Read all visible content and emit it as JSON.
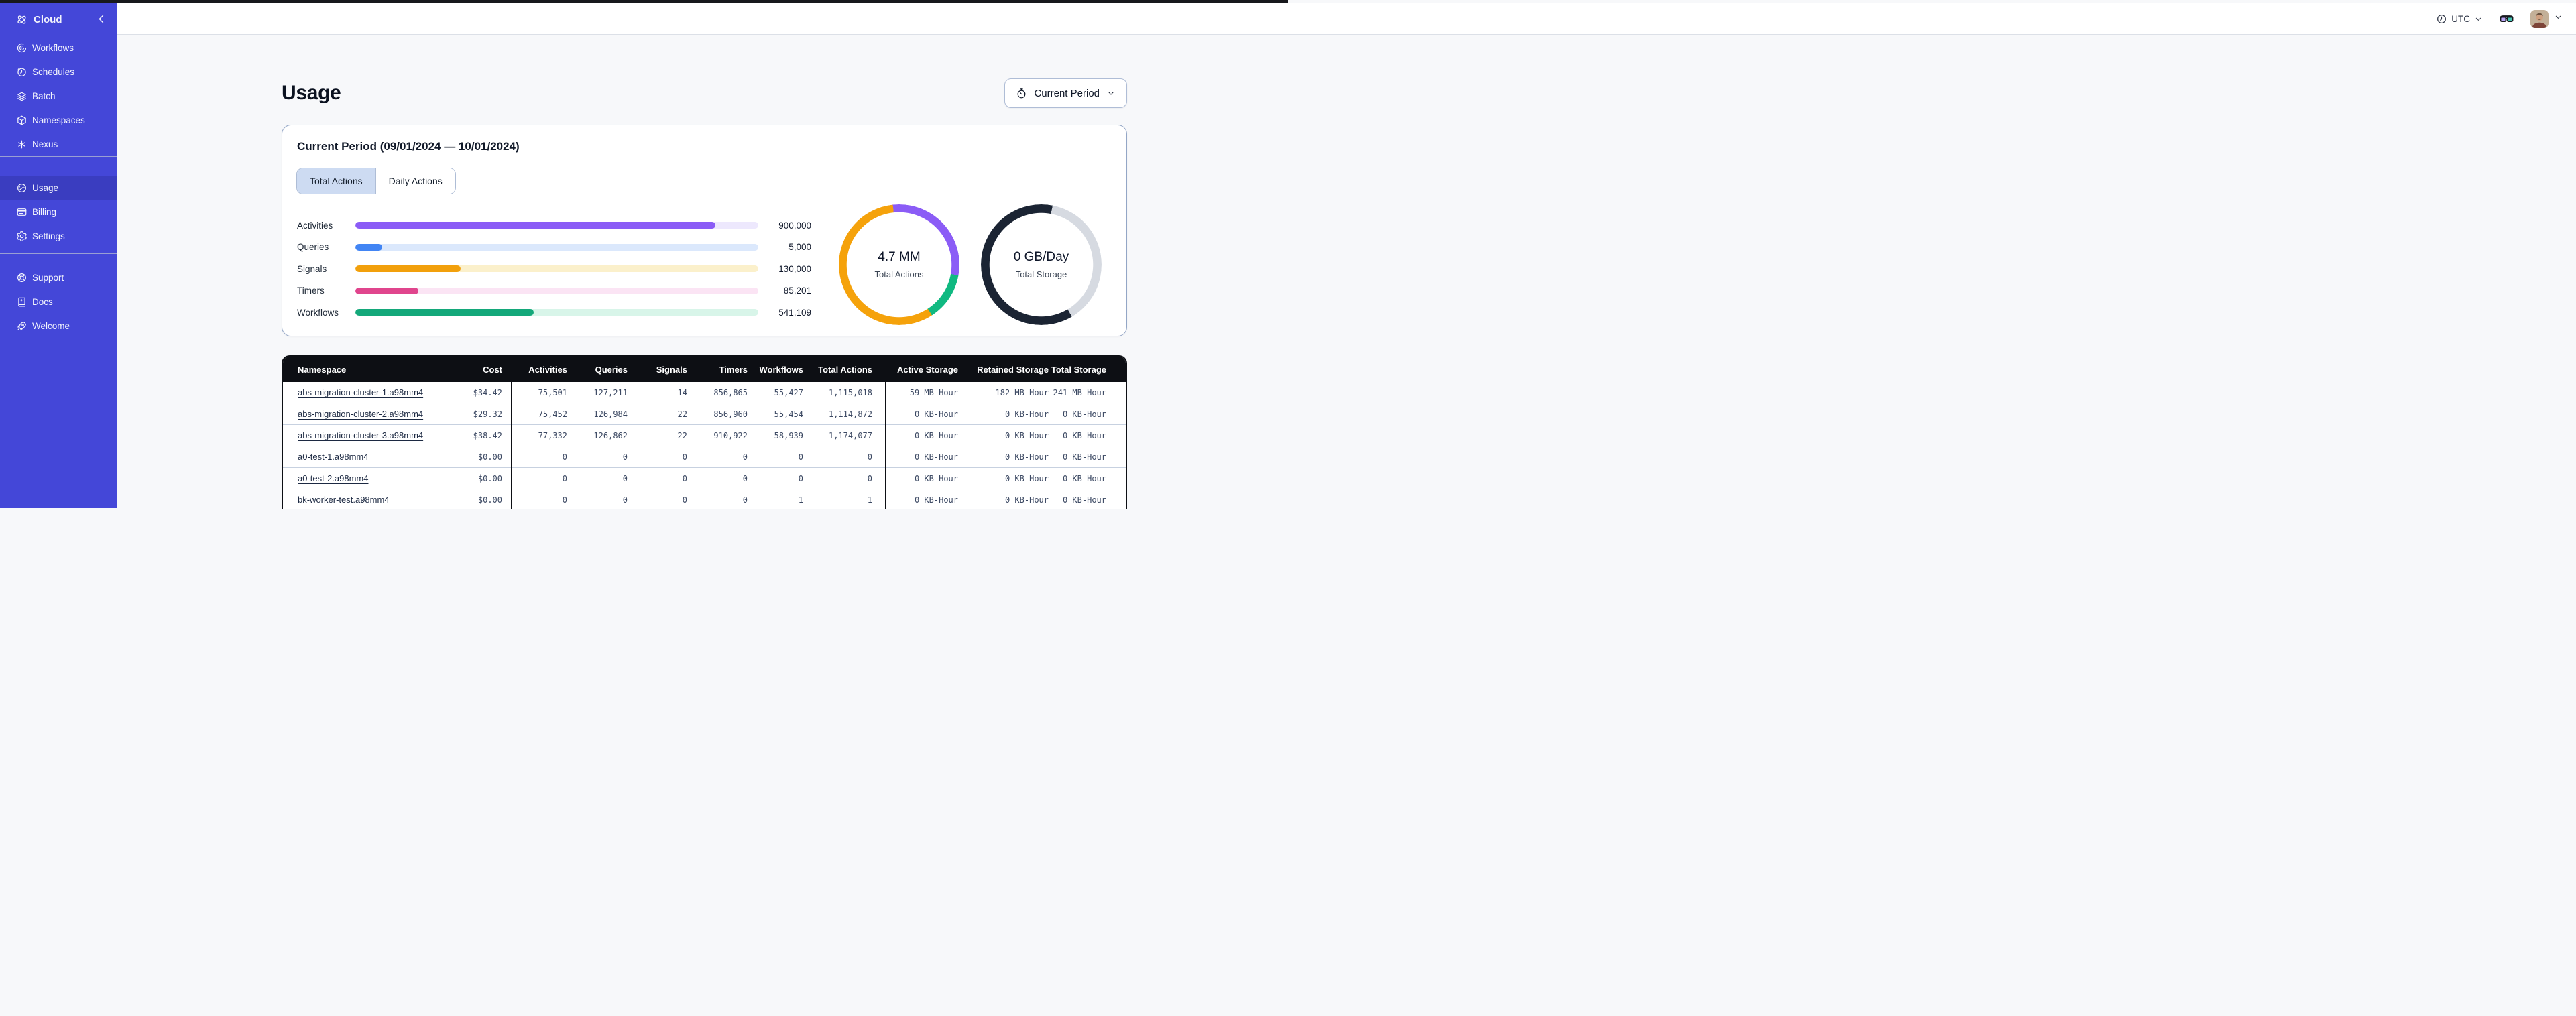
{
  "topbar": {
    "timezone": "UTC"
  },
  "sidebar": {
    "brand": {
      "label": "Cloud",
      "icon": "temporal-logo-icon"
    },
    "groups": [
      {
        "items": [
          {
            "label": "Workflows",
            "icon": "workflows-icon"
          },
          {
            "label": "Schedules",
            "icon": "schedules-icon"
          },
          {
            "label": "Batch",
            "icon": "batch-icon"
          },
          {
            "label": "Namespaces",
            "icon": "namespaces-icon"
          },
          {
            "label": "Nexus",
            "icon": "nexus-icon"
          }
        ]
      },
      {
        "items": [
          {
            "label": "Usage",
            "icon": "usage-icon",
            "active": true
          },
          {
            "label": "Billing",
            "icon": "billing-icon"
          },
          {
            "label": "Settings",
            "icon": "settings-icon"
          }
        ]
      },
      {
        "items": [
          {
            "label": "Support",
            "icon": "support-icon"
          },
          {
            "label": "Docs",
            "icon": "docs-icon"
          },
          {
            "label": "Welcome",
            "icon": "welcome-icon"
          }
        ]
      }
    ]
  },
  "page": {
    "title": "Usage",
    "period_button": "Current Period"
  },
  "usage_card": {
    "heading": "Current Period (09/01/2024 — 10/01/2024)",
    "tabs": [
      {
        "label": "Total Actions",
        "selected": true
      },
      {
        "label": "Daily Actions",
        "selected": false
      }
    ]
  },
  "chart_data": [
    {
      "type": "bar",
      "title": "Total Actions by type",
      "orientation": "horizontal",
      "categories": [
        "Activities",
        "Queries",
        "Signals",
        "Timers",
        "Workflows"
      ],
      "values": [
        900000,
        5000,
        130000,
        85201,
        541109
      ],
      "value_labels": [
        "900,000",
        "5,000",
        "130,000",
        "85,201",
        "541,109"
      ],
      "fill_percents": [
        89.4,
        6.7,
        26.2,
        15.6,
        44.2
      ],
      "bar_colors": [
        "#8B5CF6",
        "#4285F4",
        "#F2A00C",
        "#E0458D",
        "#14A87A"
      ],
      "track_colors": [
        "#EDE8FD",
        "#DBE8FC",
        "#FBF0CB",
        "#FBE4F4",
        "#D8F5E9"
      ]
    },
    {
      "type": "donut",
      "center_value": "4.7 MM",
      "center_label": "Total Actions",
      "start_deg": -6,
      "thickness_px": 12,
      "segments": [
        {
          "color": "#8B5CF6",
          "from_pct": 0,
          "to_pct": 29.5
        },
        {
          "color": "#10B981",
          "from_pct": 29.5,
          "to_pct": 42.5
        },
        {
          "color": "#F5A20B",
          "from_pct": 42.5,
          "to_pct": 100
        }
      ]
    },
    {
      "type": "donut",
      "center_value": "0 GB/Day",
      "center_label": "Total Storage",
      "start_deg": 0,
      "thickness_px": 13,
      "segments": [
        {
          "color": "#1B2433",
          "from_pct": 0,
          "to_pct": 3
        },
        {
          "color": "#D6DAE1",
          "from_pct": 3,
          "to_pct": 41.5
        },
        {
          "color": "#1B2433",
          "from_pct": 41.5,
          "to_pct": 100
        }
      ]
    }
  ],
  "table": {
    "columns": [
      "Namespace",
      "Cost",
      "Activities",
      "Queries",
      "Signals",
      "Timers",
      "Workflows",
      "Total Actions",
      "Active Storage",
      "Retained Storage",
      "Total Storage"
    ],
    "rows": [
      [
        "abs-migration-cluster-1.a98mm4",
        "$34.42",
        "75,501",
        "127,211",
        "14",
        "856,865",
        "55,427",
        "1,115,018",
        "59 MB-Hour",
        "182 MB-Hour",
        "241 MB-Hour"
      ],
      [
        "abs-migration-cluster-2.a98mm4",
        "$29.32",
        "75,452",
        "126,984",
        "22",
        "856,960",
        "55,454",
        "1,114,872",
        "0 KB-Hour",
        "0 KB-Hour",
        "0 KB-Hour"
      ],
      [
        "abs-migration-cluster-3.a98mm4",
        "$38.42",
        "77,332",
        "126,862",
        "22",
        "910,922",
        "58,939",
        "1,174,077",
        "0 KB-Hour",
        "0 KB-Hour",
        "0 KB-Hour"
      ],
      [
        "a0-test-1.a98mm4",
        "$0.00",
        "0",
        "0",
        "0",
        "0",
        "0",
        "0",
        "0 KB-Hour",
        "0 KB-Hour",
        "0 KB-Hour"
      ],
      [
        "a0-test-2.a98mm4",
        "$0.00",
        "0",
        "0",
        "0",
        "0",
        "0",
        "0",
        "0 KB-Hour",
        "0 KB-Hour",
        "0 KB-Hour"
      ],
      [
        "bk-worker-test.a98mm4",
        "$0.00",
        "0",
        "0",
        "0",
        "0",
        "1",
        "1",
        "0 KB-Hour",
        "0 KB-Hour",
        "0 KB-Hour"
      ]
    ]
  },
  "colors": {
    "sidebar": "#4447D8",
    "sidebar_active": "#3A3DC0",
    "table_header": "#0D0F14",
    "page_bg": "#F7F8FA",
    "donut_dark": "#1B2433",
    "donut_gray": "#D6DAE1"
  }
}
